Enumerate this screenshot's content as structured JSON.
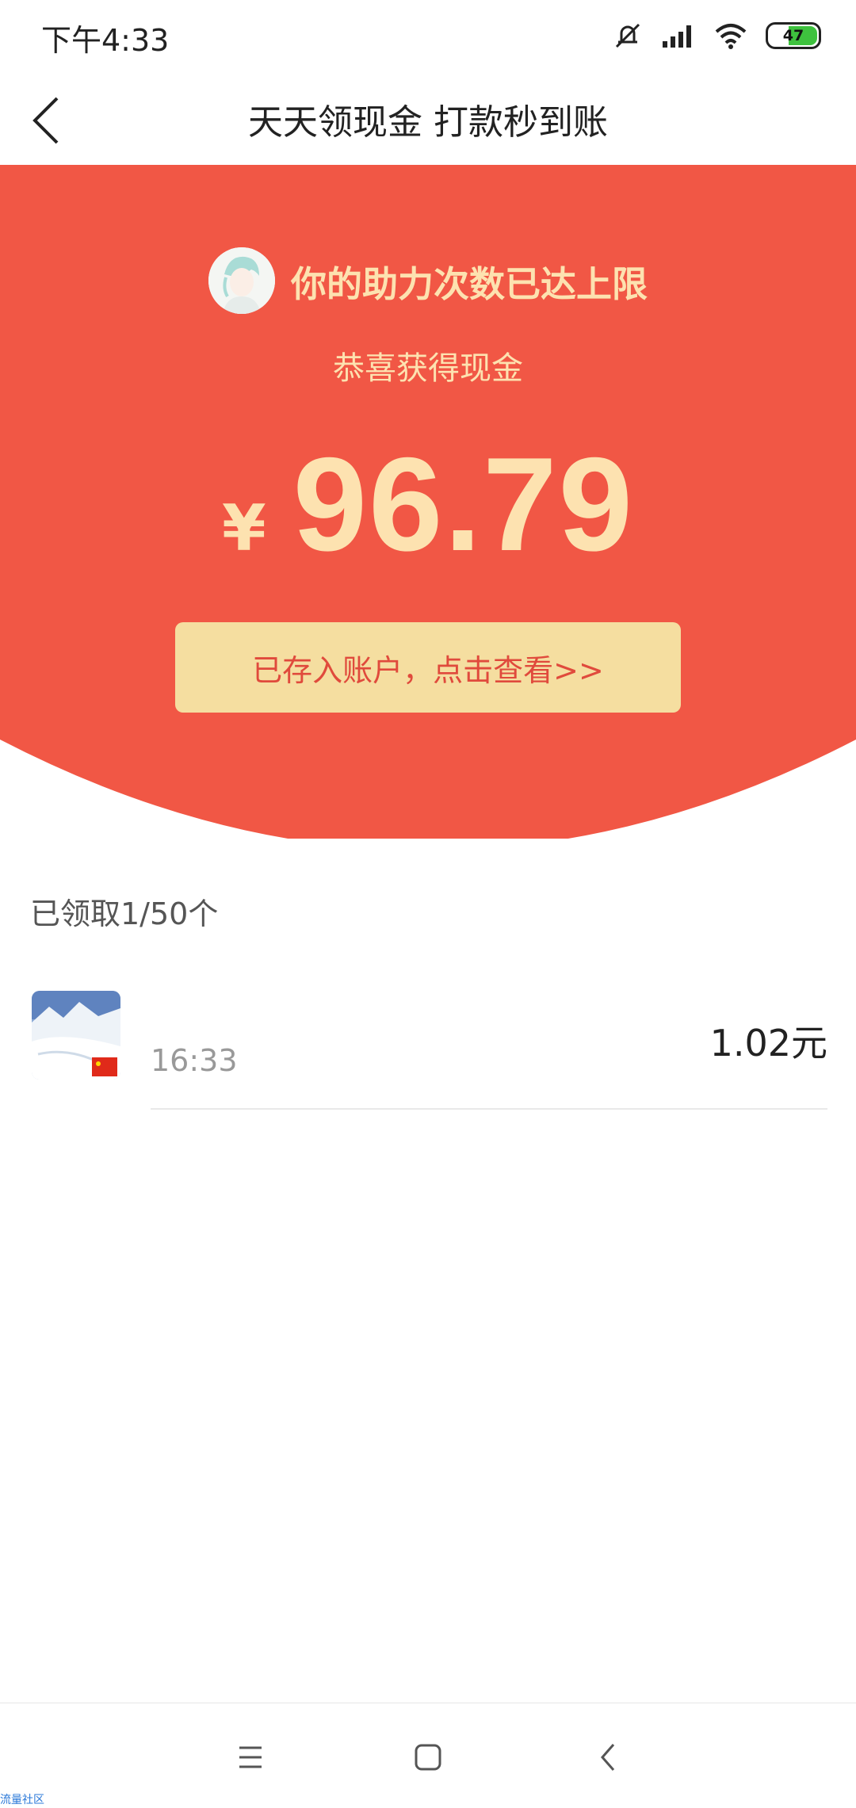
{
  "status_bar": {
    "time": "下午4:33",
    "battery": "47",
    "icons": [
      "mute-icon",
      "signal-icon",
      "wifi-icon",
      "battery-icon"
    ]
  },
  "nav": {
    "title": "天天领现金 打款秒到账",
    "back_icon": "chevron-left-icon"
  },
  "reward": {
    "headline": "你的助力次数已达上限",
    "congrats": "恭喜获得现金",
    "currency": "¥",
    "amount": "96.79",
    "cta": "已存入账户，点击查看>>"
  },
  "records": {
    "summary": "已领取1/50个",
    "items": [
      {
        "time": "16:33",
        "amount": "1.02元"
      }
    ]
  },
  "system_nav": [
    "menu-icon",
    "home-icon",
    "back-icon"
  ],
  "watermark": "流量社区",
  "colors": {
    "red": "#f15745",
    "gold_text": "#fde2b0",
    "button_bg": "#f5dea0",
    "button_text": "#e04a3c"
  }
}
